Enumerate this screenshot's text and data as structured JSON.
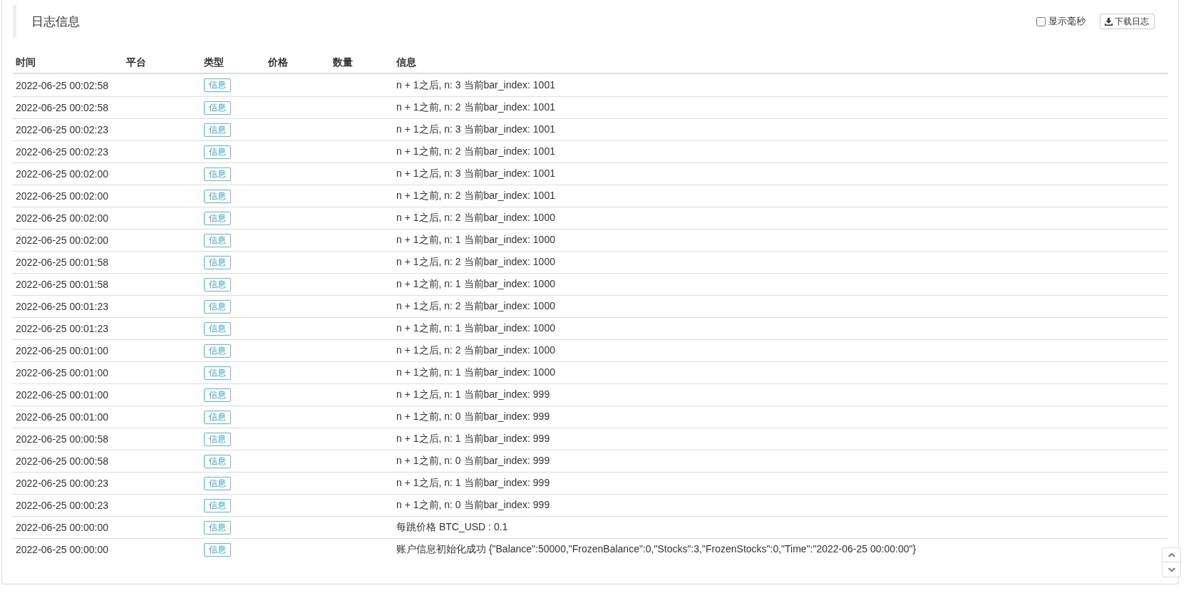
{
  "panel": {
    "title": "日志信息",
    "show_ms": {
      "label": "显示毫秒",
      "checked": false
    },
    "download_button": {
      "label": "下载日志"
    }
  },
  "table": {
    "columns": [
      "时间",
      "平台",
      "类型",
      "价格",
      "数量",
      "信息"
    ],
    "rows": [
      {
        "time": "2022-06-25 00:02:58",
        "type": "信息",
        "message": "n + 1之后, n: 3 当前bar_index: 1001"
      },
      {
        "time": "2022-06-25 00:02:58",
        "type": "信息",
        "message": "n + 1之前, n: 2 当前bar_index: 1001"
      },
      {
        "time": "2022-06-25 00:02:23",
        "type": "信息",
        "message": "n + 1之后, n: 3 当前bar_index: 1001"
      },
      {
        "time": "2022-06-25 00:02:23",
        "type": "信息",
        "message": "n + 1之前, n: 2 当前bar_index: 1001"
      },
      {
        "time": "2022-06-25 00:02:00",
        "type": "信息",
        "message": "n + 1之后, n: 3 当前bar_index: 1001"
      },
      {
        "time": "2022-06-25 00:02:00",
        "type": "信息",
        "message": "n + 1之前, n: 2 当前bar_index: 1001"
      },
      {
        "time": "2022-06-25 00:02:00",
        "type": "信息",
        "message": "n + 1之后, n: 2 当前bar_index: 1000"
      },
      {
        "time": "2022-06-25 00:02:00",
        "type": "信息",
        "message": "n + 1之前, n: 1 当前bar_index: 1000"
      },
      {
        "time": "2022-06-25 00:01:58",
        "type": "信息",
        "message": "n + 1之后, n: 2 当前bar_index: 1000"
      },
      {
        "time": "2022-06-25 00:01:58",
        "type": "信息",
        "message": "n + 1之前, n: 1 当前bar_index: 1000"
      },
      {
        "time": "2022-06-25 00:01:23",
        "type": "信息",
        "message": "n + 1之后, n: 2 当前bar_index: 1000"
      },
      {
        "time": "2022-06-25 00:01:23",
        "type": "信息",
        "message": "n + 1之前, n: 1 当前bar_index: 1000"
      },
      {
        "time": "2022-06-25 00:01:00",
        "type": "信息",
        "message": "n + 1之后, n: 2 当前bar_index: 1000"
      },
      {
        "time": "2022-06-25 00:01:00",
        "type": "信息",
        "message": "n + 1之前, n: 1 当前bar_index: 1000"
      },
      {
        "time": "2022-06-25 00:01:00",
        "type": "信息",
        "message": "n + 1之后, n: 1 当前bar_index: 999"
      },
      {
        "time": "2022-06-25 00:01:00",
        "type": "信息",
        "message": "n + 1之前, n: 0 当前bar_index: 999"
      },
      {
        "time": "2022-06-25 00:00:58",
        "type": "信息",
        "message": "n + 1之后, n: 1 当前bar_index: 999"
      },
      {
        "time": "2022-06-25 00:00:58",
        "type": "信息",
        "message": "n + 1之前, n: 0 当前bar_index: 999"
      },
      {
        "time": "2022-06-25 00:00:23",
        "type": "信息",
        "message": "n + 1之后, n: 1 当前bar_index: 999"
      },
      {
        "time": "2022-06-25 00:00:23",
        "type": "信息",
        "message": "n + 1之前, n: 0 当前bar_index: 999"
      },
      {
        "time": "2022-06-25 00:00:00",
        "type": "信息",
        "message": "每跳价格 BTC_USD : 0.1"
      },
      {
        "time": "2022-06-25 00:00:00",
        "type": "信息",
        "message": "账户信息初始化成功 {\"Balance\":50000,\"FrozenBalance\":0,\"Stocks\":3,\"FrozenStocks\":0,\"Time\":\"2022-06-25 00:00:00\"}"
      }
    ]
  }
}
